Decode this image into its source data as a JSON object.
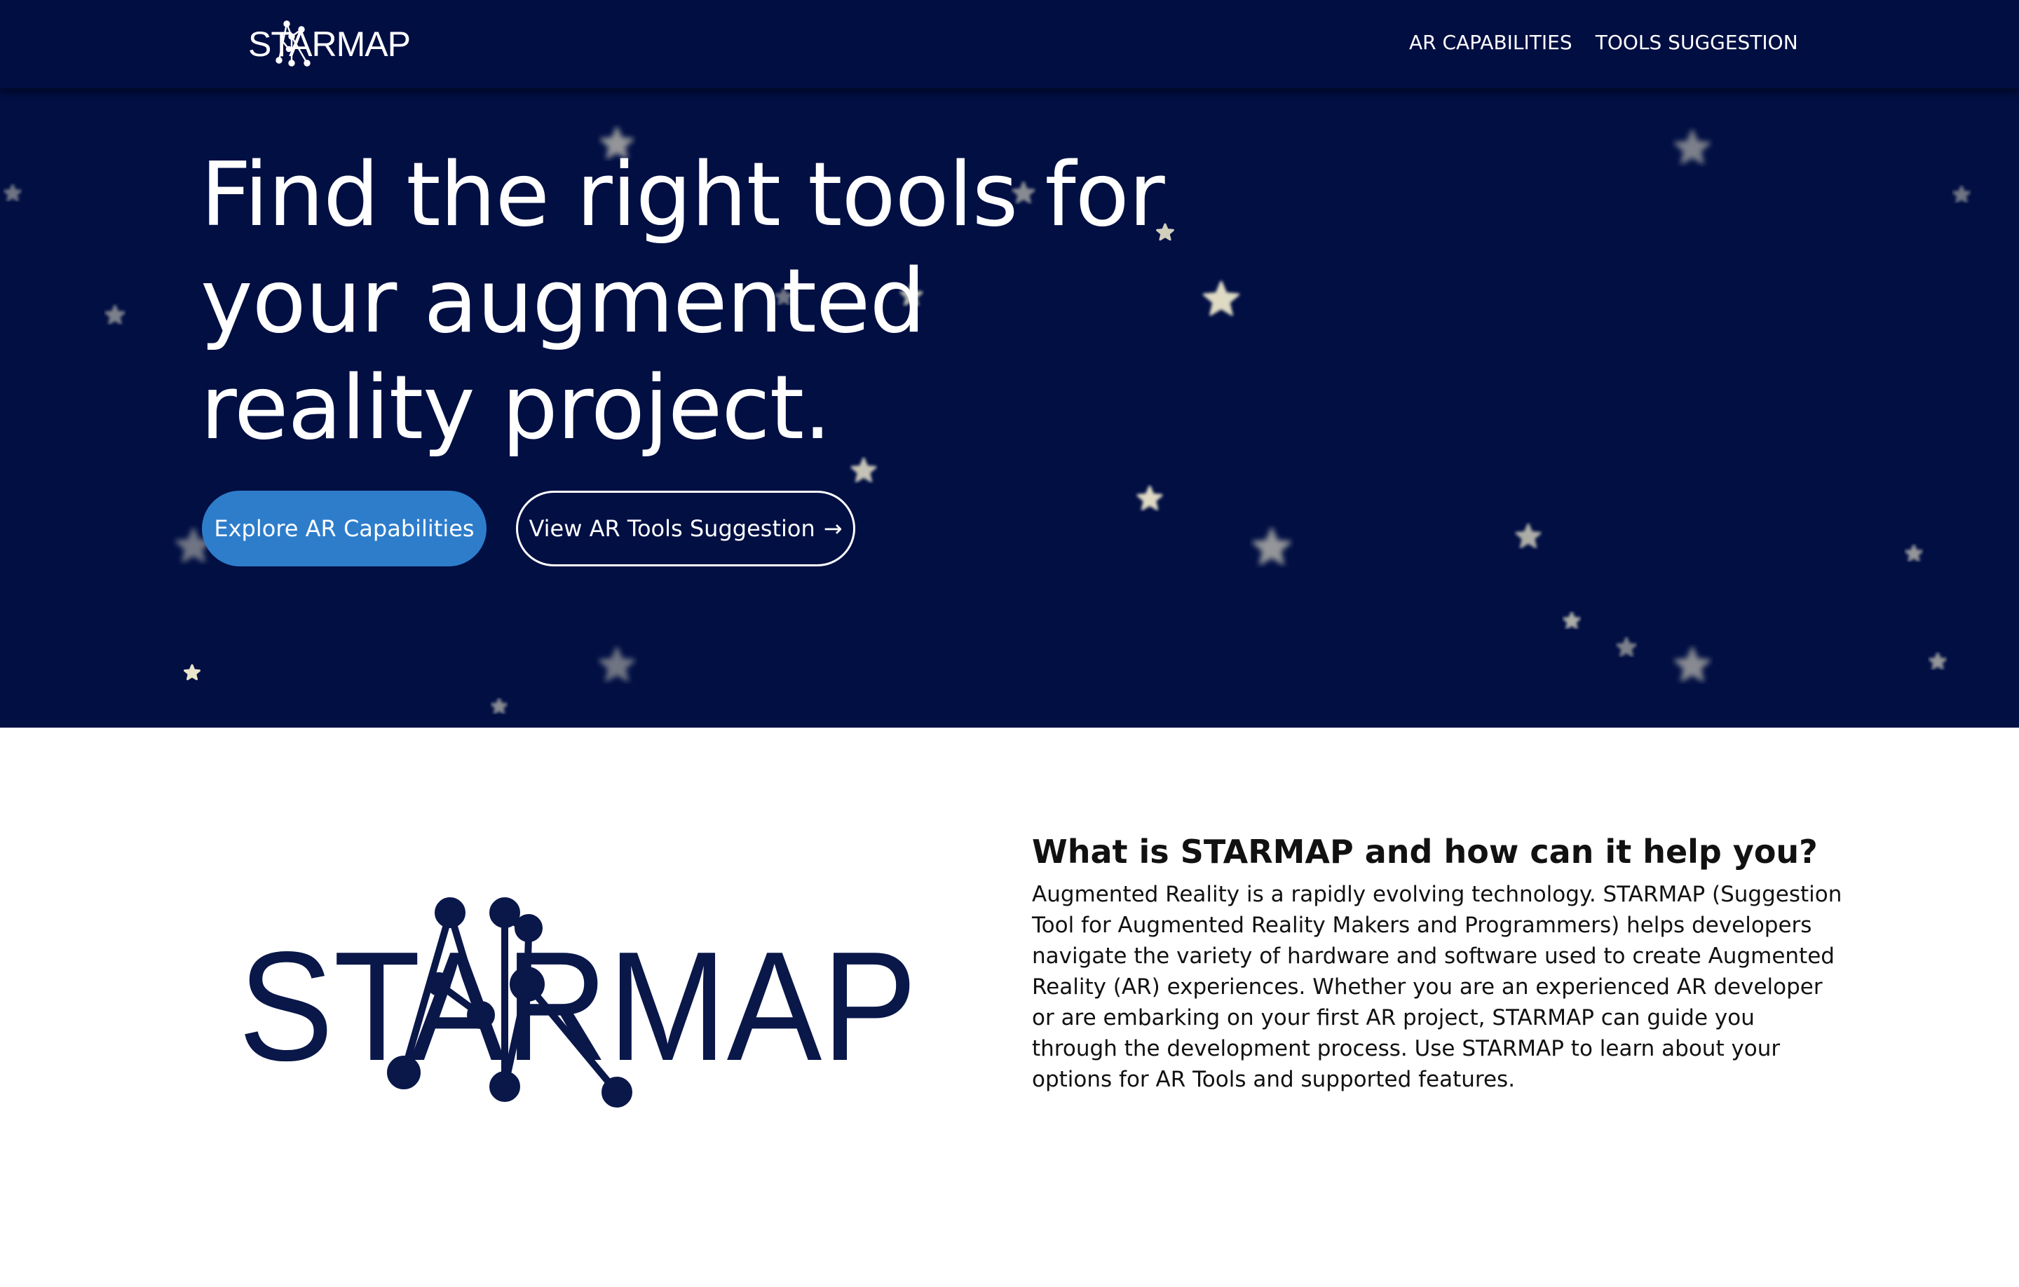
{
  "brand": {
    "name": "STARMAP",
    "logo_label": "STARMAP"
  },
  "nav": {
    "items": [
      "AR CAPABILITIES",
      "TOOLS SUGGESTION"
    ]
  },
  "hero": {
    "title": "Find the right tools for your augmented reality project.",
    "primary_button": "Explore AR Capabilities",
    "secondary_button": "View AR Tools Suggestion",
    "secondary_button_arrow": "→"
  },
  "about": {
    "logo_text": "STARMAP",
    "heading": "What is STARMAP and how can it help you?",
    "body": "Augmented Reality is a rapidly evolving technology. STARMAP (Suggestion Tool for Augmented Reality Makers and Programmers) helps developers navigate the variety of hardware and software used to create Augmented Reality (AR) experiences. Whether you are an experienced AR developer or are embarking on your first AR project, STARMAP can guide you through the development process. Use STARMAP to learn about your options for AR Tools and supported features."
  },
  "colors": {
    "navbar_bg": "#010e42",
    "hero_bg": "#010f43",
    "primary_button_bg": "#2e7dcb",
    "logo_navy": "#0a1749",
    "star_color": "#f6f0d2"
  }
}
